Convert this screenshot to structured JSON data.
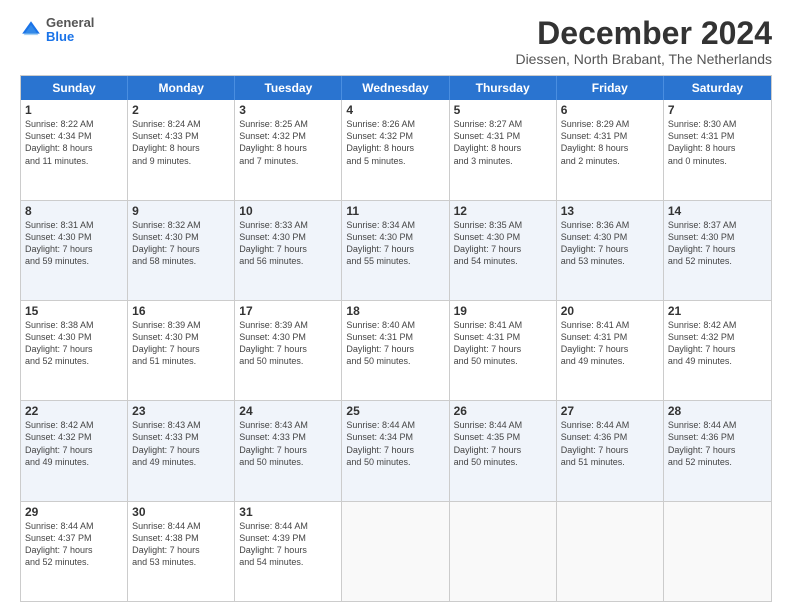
{
  "logo": {
    "line1": "General",
    "line2": "Blue"
  },
  "title": "December 2024",
  "subtitle": "Diessen, North Brabant, The Netherlands",
  "weekdays": [
    "Sunday",
    "Monday",
    "Tuesday",
    "Wednesday",
    "Thursday",
    "Friday",
    "Saturday"
  ],
  "weeks": [
    [
      {
        "day": "1",
        "info": "Sunrise: 8:22 AM\nSunset: 4:34 PM\nDaylight: 8 hours\nand 11 minutes."
      },
      {
        "day": "2",
        "info": "Sunrise: 8:24 AM\nSunset: 4:33 PM\nDaylight: 8 hours\nand 9 minutes."
      },
      {
        "day": "3",
        "info": "Sunrise: 8:25 AM\nSunset: 4:32 PM\nDaylight: 8 hours\nand 7 minutes."
      },
      {
        "day": "4",
        "info": "Sunrise: 8:26 AM\nSunset: 4:32 PM\nDaylight: 8 hours\nand 5 minutes."
      },
      {
        "day": "5",
        "info": "Sunrise: 8:27 AM\nSunset: 4:31 PM\nDaylight: 8 hours\nand 3 minutes."
      },
      {
        "day": "6",
        "info": "Sunrise: 8:29 AM\nSunset: 4:31 PM\nDaylight: 8 hours\nand 2 minutes."
      },
      {
        "day": "7",
        "info": "Sunrise: 8:30 AM\nSunset: 4:31 PM\nDaylight: 8 hours\nand 0 minutes."
      }
    ],
    [
      {
        "day": "8",
        "info": "Sunrise: 8:31 AM\nSunset: 4:30 PM\nDaylight: 7 hours\nand 59 minutes."
      },
      {
        "day": "9",
        "info": "Sunrise: 8:32 AM\nSunset: 4:30 PM\nDaylight: 7 hours\nand 58 minutes."
      },
      {
        "day": "10",
        "info": "Sunrise: 8:33 AM\nSunset: 4:30 PM\nDaylight: 7 hours\nand 56 minutes."
      },
      {
        "day": "11",
        "info": "Sunrise: 8:34 AM\nSunset: 4:30 PM\nDaylight: 7 hours\nand 55 minutes."
      },
      {
        "day": "12",
        "info": "Sunrise: 8:35 AM\nSunset: 4:30 PM\nDaylight: 7 hours\nand 54 minutes."
      },
      {
        "day": "13",
        "info": "Sunrise: 8:36 AM\nSunset: 4:30 PM\nDaylight: 7 hours\nand 53 minutes."
      },
      {
        "day": "14",
        "info": "Sunrise: 8:37 AM\nSunset: 4:30 PM\nDaylight: 7 hours\nand 52 minutes."
      }
    ],
    [
      {
        "day": "15",
        "info": "Sunrise: 8:38 AM\nSunset: 4:30 PM\nDaylight: 7 hours\nand 52 minutes."
      },
      {
        "day": "16",
        "info": "Sunrise: 8:39 AM\nSunset: 4:30 PM\nDaylight: 7 hours\nand 51 minutes."
      },
      {
        "day": "17",
        "info": "Sunrise: 8:39 AM\nSunset: 4:30 PM\nDaylight: 7 hours\nand 50 minutes."
      },
      {
        "day": "18",
        "info": "Sunrise: 8:40 AM\nSunset: 4:31 PM\nDaylight: 7 hours\nand 50 minutes."
      },
      {
        "day": "19",
        "info": "Sunrise: 8:41 AM\nSunset: 4:31 PM\nDaylight: 7 hours\nand 50 minutes."
      },
      {
        "day": "20",
        "info": "Sunrise: 8:41 AM\nSunset: 4:31 PM\nDaylight: 7 hours\nand 49 minutes."
      },
      {
        "day": "21",
        "info": "Sunrise: 8:42 AM\nSunset: 4:32 PM\nDaylight: 7 hours\nand 49 minutes."
      }
    ],
    [
      {
        "day": "22",
        "info": "Sunrise: 8:42 AM\nSunset: 4:32 PM\nDaylight: 7 hours\nand 49 minutes."
      },
      {
        "day": "23",
        "info": "Sunrise: 8:43 AM\nSunset: 4:33 PM\nDaylight: 7 hours\nand 49 minutes."
      },
      {
        "day": "24",
        "info": "Sunrise: 8:43 AM\nSunset: 4:33 PM\nDaylight: 7 hours\nand 50 minutes."
      },
      {
        "day": "25",
        "info": "Sunrise: 8:44 AM\nSunset: 4:34 PM\nDaylight: 7 hours\nand 50 minutes."
      },
      {
        "day": "26",
        "info": "Sunrise: 8:44 AM\nSunset: 4:35 PM\nDaylight: 7 hours\nand 50 minutes."
      },
      {
        "day": "27",
        "info": "Sunrise: 8:44 AM\nSunset: 4:36 PM\nDaylight: 7 hours\nand 51 minutes."
      },
      {
        "day": "28",
        "info": "Sunrise: 8:44 AM\nSunset: 4:36 PM\nDaylight: 7 hours\nand 52 minutes."
      }
    ],
    [
      {
        "day": "29",
        "info": "Sunrise: 8:44 AM\nSunset: 4:37 PM\nDaylight: 7 hours\nand 52 minutes."
      },
      {
        "day": "30",
        "info": "Sunrise: 8:44 AM\nSunset: 4:38 PM\nDaylight: 7 hours\nand 53 minutes."
      },
      {
        "day": "31",
        "info": "Sunrise: 8:44 AM\nSunset: 4:39 PM\nDaylight: 7 hours\nand 54 minutes."
      },
      {
        "day": "",
        "info": ""
      },
      {
        "day": "",
        "info": ""
      },
      {
        "day": "",
        "info": ""
      },
      {
        "day": "",
        "info": ""
      }
    ]
  ]
}
